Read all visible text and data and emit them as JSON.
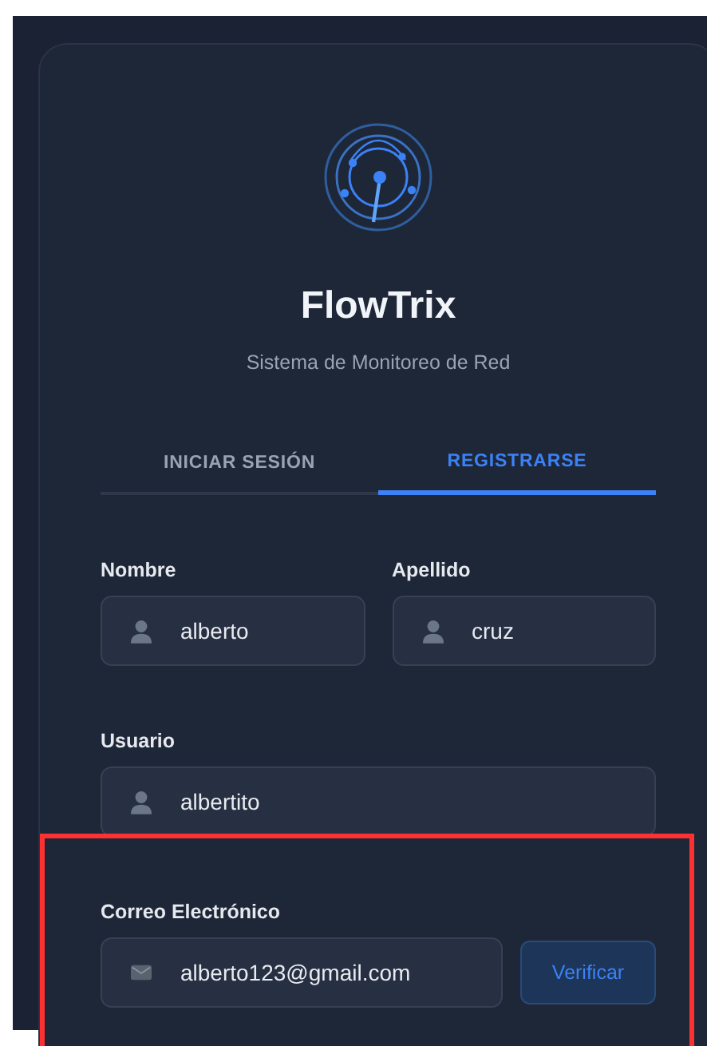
{
  "app": {
    "name": "FlowTrix",
    "subtitle": "Sistema de Monitoreo de Red"
  },
  "tabs": [
    {
      "label": "INICIAR SESIÓN",
      "selected": false
    },
    {
      "label": "REGISTRARSE",
      "selected": true
    }
  ],
  "form": {
    "rows": [
      {
        "fields": [
          {
            "label": "Nombre",
            "value": "alberto",
            "kind": "name"
          },
          {
            "label": "Apellido",
            "value": "cruz",
            "kind": "name"
          }
        ]
      },
      {
        "fields": [
          {
            "label": "Usuario",
            "value": "albertito",
            "kind": "name"
          }
        ]
      },
      {
        "fields": [
          {
            "label": "Correo Electrónico",
            "value": "alberto123@gmail.com",
            "kind": "email",
            "button": "Verificar"
          }
        ]
      }
    ]
  }
}
